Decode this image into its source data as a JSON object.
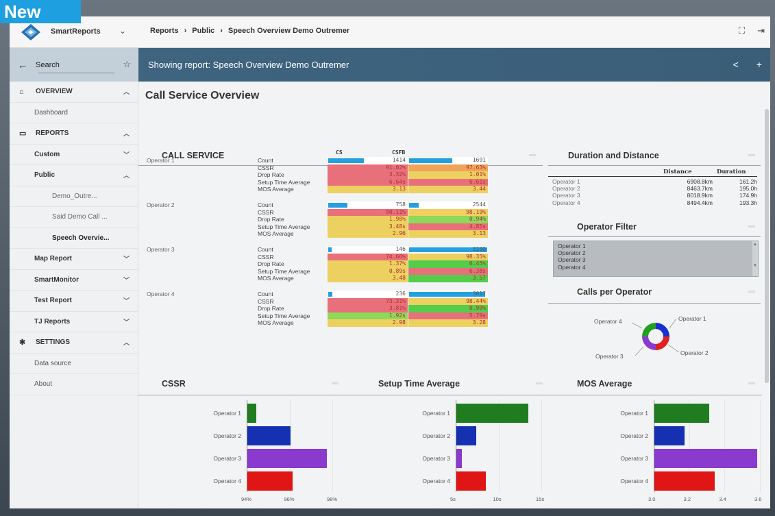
{
  "badge": "New",
  "header": {
    "app_name": "SmartReports",
    "breadcrumbs": [
      "Reports",
      "Public",
      "Speech Overview Demo Outremer"
    ]
  },
  "sidebar": {
    "search_label": "Search",
    "items": [
      {
        "label": "OVERVIEW",
        "kind": "section",
        "icon": "home-icon",
        "chevron": "up"
      },
      {
        "label": "Dashboard",
        "kind": "leaf"
      },
      {
        "label": "REPORTS",
        "kind": "section",
        "icon": "folder-icon",
        "chevron": "up"
      },
      {
        "label": "Custom",
        "kind": "sub",
        "chevron": "down"
      },
      {
        "label": "Public",
        "kind": "sub",
        "chevron": "up"
      },
      {
        "label": "Demo_Outre...",
        "kind": "leaf2"
      },
      {
        "label": "Said Demo Call ...",
        "kind": "leaf2"
      },
      {
        "label": "Speech Overvie...",
        "kind": "leaf2",
        "selected": true
      },
      {
        "label": "Map Report",
        "kind": "sub",
        "chevron": "down"
      },
      {
        "label": "SmartMonitor",
        "kind": "sub",
        "chevron": "down"
      },
      {
        "label": "Test Report",
        "kind": "sub",
        "chevron": "down"
      },
      {
        "label": "TJ Reports",
        "kind": "sub",
        "chevron": "down"
      },
      {
        "label": "SETTINGS",
        "kind": "section",
        "icon": "gear-icon",
        "chevron": "up"
      },
      {
        "label": "Data source",
        "kind": "leaf"
      },
      {
        "label": "About",
        "kind": "leaf"
      }
    ]
  },
  "banner": {
    "text": "Showing report: Speech Overview Demo Outremer"
  },
  "page": {
    "title": "Call Service Overview"
  },
  "call_service": {
    "title": "CALL SERVICE",
    "columns": [
      "CS",
      "CSFB"
    ],
    "operators": [
      {
        "name": "Operator 1",
        "rows": [
          {
            "metric": "Count",
            "cs": "1414",
            "csfb": "1691",
            "cs_fill": 0.45,
            "csfb_fill": 0.55
          },
          {
            "metric": "CSSR",
            "cs": "91.02%",
            "csfb": "97.63%",
            "cs_color": "#e8707a",
            "csfb_color": "#f0a45a"
          },
          {
            "metric": "Drop Rate",
            "cs": "3.32%",
            "csfb": "1.01%",
            "cs_color": "#e8707a",
            "csfb_color": "#ecd060"
          },
          {
            "metric": "Setup Time Average",
            "cs": "6.64s",
            "csfb": "6.61s",
            "cs_color": "#e8707a",
            "csfb_color": "#e8707a"
          },
          {
            "metric": "MOS Average",
            "cs": "3.13",
            "csfb": "3.44",
            "cs_color": "#ecd060",
            "csfb_color": "#ecd060"
          }
        ]
      },
      {
        "name": "Operator 2",
        "rows": [
          {
            "metric": "Count",
            "cs": "758",
            "csfb": "2544",
            "cs_fill": 0.24,
            "csfb_fill": 0.12
          },
          {
            "metric": "CSSR",
            "cs": "90.11%",
            "csfb": "98.19%",
            "cs_color": "#e8707a",
            "csfb_color": "#f0d060"
          },
          {
            "metric": "Drop Rate",
            "cs": "1.98%",
            "csfb": "0.94%",
            "cs_color": "#ecd060",
            "csfb_color": "#8ed85a"
          },
          {
            "metric": "Setup Time Average",
            "cs": "3.48s",
            "csfb": "4.85s",
            "cs_color": "#ecd060",
            "csfb_color": "#e8707a"
          },
          {
            "metric": "MOS Average",
            "cs": "2.96",
            "csfb": "3.13",
            "cs_color": "#ecd060",
            "csfb_color": "#ecd060"
          }
        ]
      },
      {
        "name": "Operator 3",
        "rows": [
          {
            "metric": "Count",
            "cs": "146",
            "csfb": "3100",
            "cs_fill": 0.04,
            "csfb_fill": 1.0
          },
          {
            "metric": "CSSR",
            "cs": "74.66%",
            "csfb": "98.35%",
            "cs_color": "#e8707a",
            "csfb_color": "#ecd060"
          },
          {
            "metric": "Drop Rate",
            "cs": "1.37%",
            "csfb": "0.45%",
            "cs_color": "#ecd060",
            "csfb_color": "#55cc4a"
          },
          {
            "metric": "Setup Time Average",
            "cs": "0.89s",
            "csfb": "6.38s",
            "cs_color": "#ecd060",
            "csfb_color": "#e8707a"
          },
          {
            "metric": "MOS Average",
            "cs": "3.48",
            "csfb": "3.57",
            "cs_color": "#ecd060",
            "csfb_color": "#55cc4a"
          }
        ]
      },
      {
        "name": "Operator 4",
        "rows": [
          {
            "metric": "Count",
            "cs": "236",
            "csfb": "3017",
            "cs_fill": 0.05,
            "csfb_fill": 0.97
          },
          {
            "metric": "CSSR",
            "cs": "73.31%",
            "csfb": "98.44%",
            "cs_color": "#e8707a",
            "csfb_color": "#ecd060"
          },
          {
            "metric": "Drop Rate",
            "cs": "3.81%",
            "csfb": "0.90%",
            "cs_color": "#e8707a",
            "csfb_color": "#55cc4a"
          },
          {
            "metric": "Setup Time Average",
            "cs": "1.92s",
            "csfb": "5.79s",
            "cs_color": "#8ed85a",
            "csfb_color": "#e8707a"
          },
          {
            "metric": "MOS Average",
            "cs": "2.98",
            "csfb": "3.28",
            "cs_color": "#ecd060",
            "csfb_color": "#ecd060"
          }
        ]
      }
    ]
  },
  "duration_distance": {
    "title": "Duration and Distance",
    "headers": [
      "Distance",
      "Duration"
    ],
    "rows": [
      {
        "operator": "Operator 1",
        "distance": "6908.8km",
        "duration": "161.2h"
      },
      {
        "operator": "Operator 2",
        "distance": "8463.7km",
        "duration": "195.0h"
      },
      {
        "operator": "Operator 3",
        "distance": "8018.9km",
        "duration": "174.9h"
      },
      {
        "operator": "Operator 4",
        "distance": "8494.4km",
        "duration": "193.3h"
      }
    ]
  },
  "operator_filter": {
    "title": "Operator Filter",
    "options": [
      "Operator 1",
      "Operator 2",
      "Operator 3",
      "Operator 4"
    ]
  },
  "calls_per_operator": {
    "title": "Calls per Operator",
    "labels": [
      "Operator 4",
      "Operator 1",
      "Operator 3",
      "Operator 2"
    ],
    "colors": [
      "#22a022",
      "#1a2fd0",
      "#8a3ad0",
      "#e02020"
    ],
    "shares": [
      0.25,
      0.25,
      0.25,
      0.25
    ]
  },
  "chart_data": [
    {
      "type": "bar",
      "title": "CSSR",
      "categories": [
        "Operator 1",
        "Operator 2",
        "Operator 3",
        "Operator 4"
      ],
      "values": [
        94.4,
        96.0,
        97.7,
        96.1
      ],
      "xlim": [
        94,
        98
      ],
      "xticks": [
        "94%",
        "96%",
        "98%"
      ],
      "colors": [
        "#1f7d1f",
        "#1530b0",
        "#8a3acd",
        "#e01515"
      ]
    },
    {
      "type": "bar",
      "title": "Setup Time Average",
      "categories": [
        "Operator 1",
        "Operator 2",
        "Operator 3",
        "Operator 4"
      ],
      "values": [
        13.4,
        7.3,
        5.6,
        8.4
      ],
      "xlim": [
        5,
        15
      ],
      "xticks": [
        "5s",
        "10s",
        "15s"
      ],
      "colors": [
        "#1f7d1f",
        "#1530b0",
        "#8a3acd",
        "#e01515"
      ]
    },
    {
      "type": "bar",
      "title": "MOS Average",
      "categories": [
        "Operator 1",
        "Operator 2",
        "Operator 3",
        "Operator 4"
      ],
      "values": [
        3.31,
        3.17,
        3.58,
        3.34
      ],
      "xlim": [
        3.0,
        3.6
      ],
      "xticks": [
        "3.0",
        "3.2",
        "3.4",
        "3.6"
      ],
      "colors": [
        "#1f7d1f",
        "#1530b0",
        "#8a3acd",
        "#e01515"
      ]
    }
  ]
}
